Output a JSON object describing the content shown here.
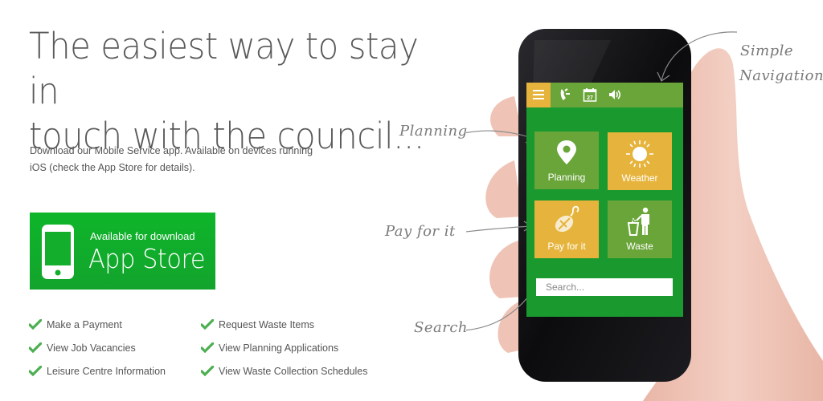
{
  "headline": {
    "line1": "The easiest way to stay in",
    "line2": "touch with the council..."
  },
  "intro": {
    "line1": "Download our Mobile Service app. Available on devices running",
    "line2": "iOS (check the App Store for details)."
  },
  "app_store_button": {
    "subtitle": "Available for download",
    "title": "App Store",
    "icon": "smartphone-icon"
  },
  "features": [
    {
      "label": "Make a Payment",
      "icon": "check-icon"
    },
    {
      "label": "View Job Vacancies",
      "icon": "check-icon"
    },
    {
      "label": "Leisure Centre Information",
      "icon": "check-icon"
    },
    {
      "label": "Request Waste Items",
      "icon": "check-icon"
    },
    {
      "label": "View Planning Applications",
      "icon": "check-icon"
    },
    {
      "label": "View Waste Collection Schedules",
      "icon": "check-icon"
    }
  ],
  "annotations": {
    "planning": "Planning",
    "pay": "Pay for it",
    "search": "Search",
    "nav_line1": "Simple",
    "nav_line2": "Navigation"
  },
  "phone_app": {
    "topbar_icons": [
      "menu-icon",
      "phone-icon",
      "calendar-icon",
      "speaker-icon"
    ],
    "calendar_day": "27",
    "tiles": [
      {
        "label": "Planning",
        "icon": "location-pin-icon",
        "color": "#6aa53a"
      },
      {
        "label": "Weather",
        "icon": "sun-icon",
        "color": "#e6b43c"
      },
      {
        "label": "Pay for it",
        "icon": "mouse-icon",
        "color": "#e6b43c"
      },
      {
        "label": "Waste",
        "icon": "waste-bin-person-icon",
        "color": "#6aa53a"
      }
    ],
    "search_placeholder": "Search..."
  },
  "colors": {
    "brand_green": "#13a42d",
    "screen_green": "#1a992f",
    "tile_green": "#6aa53a",
    "tile_yellow": "#e6b43c",
    "check_green": "#4caf50"
  }
}
